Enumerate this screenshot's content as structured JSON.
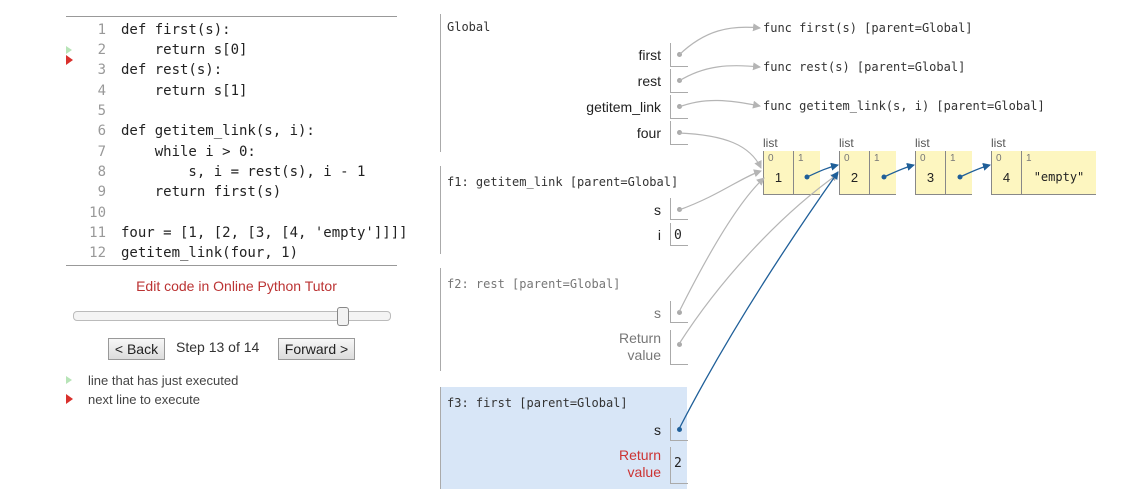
{
  "code": {
    "lines": [
      {
        "n": "1",
        "text": "def first(s):"
      },
      {
        "n": "2",
        "text": "    return s[0]"
      },
      {
        "n": "3",
        "text": "def rest(s):"
      },
      {
        "n": "4",
        "text": "    return s[1]"
      },
      {
        "n": "5",
        "text": ""
      },
      {
        "n": "6",
        "text": "def getitem_link(s, i):"
      },
      {
        "n": "7",
        "text": "    while i > 0:"
      },
      {
        "n": "8",
        "text": "        s, i = rest(s), i - 1"
      },
      {
        "n": "9",
        "text": "    return first(s)"
      },
      {
        "n": "10",
        "text": ""
      },
      {
        "n": "11",
        "text": "four = [1, [2, [3, [4, 'empty']]]]"
      },
      {
        "n": "12",
        "text": "getitem_link(four, 1)"
      }
    ]
  },
  "controls": {
    "edit_link": "Edit code in Online Python Tutor",
    "back_label": "< Back",
    "step_text": "Step 13 of 14",
    "forward_label": "Forward >",
    "step_current": 13,
    "step_total": 14
  },
  "legend": {
    "executed": "line that has just executed",
    "next": "next line to execute"
  },
  "frames": {
    "global": {
      "title": "Global",
      "vars": {
        "first": "first",
        "rest": "rest",
        "getitem_link": "getitem_link",
        "four": "four"
      }
    },
    "f1": {
      "title": "f1: getitem_link [parent=Global]",
      "s": "s",
      "i": "i",
      "i_value": "0"
    },
    "f2": {
      "title": "f2: rest [parent=Global]",
      "s": "s",
      "return_line1": "Return",
      "return_line2": "value"
    },
    "f3": {
      "title": "f3: first [parent=Global]",
      "s": "s",
      "return_line1": "Return",
      "return_line2": "value",
      "return_value": "2"
    }
  },
  "heap": {
    "funcs": {
      "first": "func first(s) [parent=Global]",
      "rest": "func rest(s) [parent=Global]",
      "getitem_link": "func getitem_link(s, i) [parent=Global]"
    },
    "lists": [
      {
        "label": "list",
        "idx0": "0",
        "idx1": "1",
        "val0": "1"
      },
      {
        "label": "list",
        "idx0": "0",
        "idx1": "1",
        "val0": "2"
      },
      {
        "label": "list",
        "idx0": "0",
        "idx1": "1",
        "val0": "3"
      },
      {
        "label": "list",
        "idx0": "0",
        "idx1": "1",
        "val0": "4",
        "val1": "\"empty\""
      }
    ]
  },
  "colors": {
    "accent": "#b33333",
    "pointer": "#1f5f99",
    "highlight_frame": "#d8e6f7",
    "list_cell": "#fdf6c0"
  }
}
